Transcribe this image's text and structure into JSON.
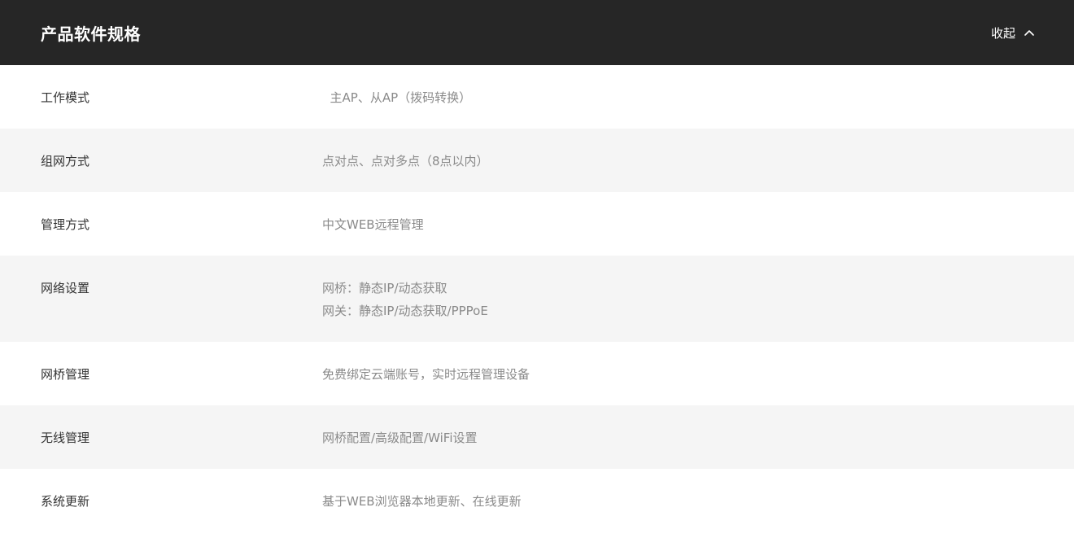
{
  "header": {
    "title": "产品软件规格",
    "collapse_label": "收起"
  },
  "specs": [
    {
      "label": "工作模式",
      "values": [
        "  主AP、从AP（拨码转换）"
      ]
    },
    {
      "label": "组网方式",
      "values": [
        "点对点、点对多点（8点以内）"
      ]
    },
    {
      "label": "管理方式",
      "values": [
        "中文WEB远程管理"
      ]
    },
    {
      "label": "网络设置",
      "values": [
        "网桥：静态IP/动态获取",
        "网关：静态IP/动态获取/PPPoE"
      ]
    },
    {
      "label": "网桥管理",
      "values": [
        "免费绑定云端账号，实时远程管理设备"
      ]
    },
    {
      "label": "无线管理",
      "values": [
        "网桥配置/高级配置/WiFi设置"
      ]
    },
    {
      "label": "系统更新",
      "values": [
        "基于WEB浏览器本地更新、在线更新"
      ]
    }
  ],
  "colors": {
    "header_bg": "#262626",
    "row_alt_bg": "#f5f5f5",
    "label_text": "#333333",
    "value_text": "#8a8a8a"
  },
  "icons": {
    "collapse": "chevron-up-icon"
  }
}
